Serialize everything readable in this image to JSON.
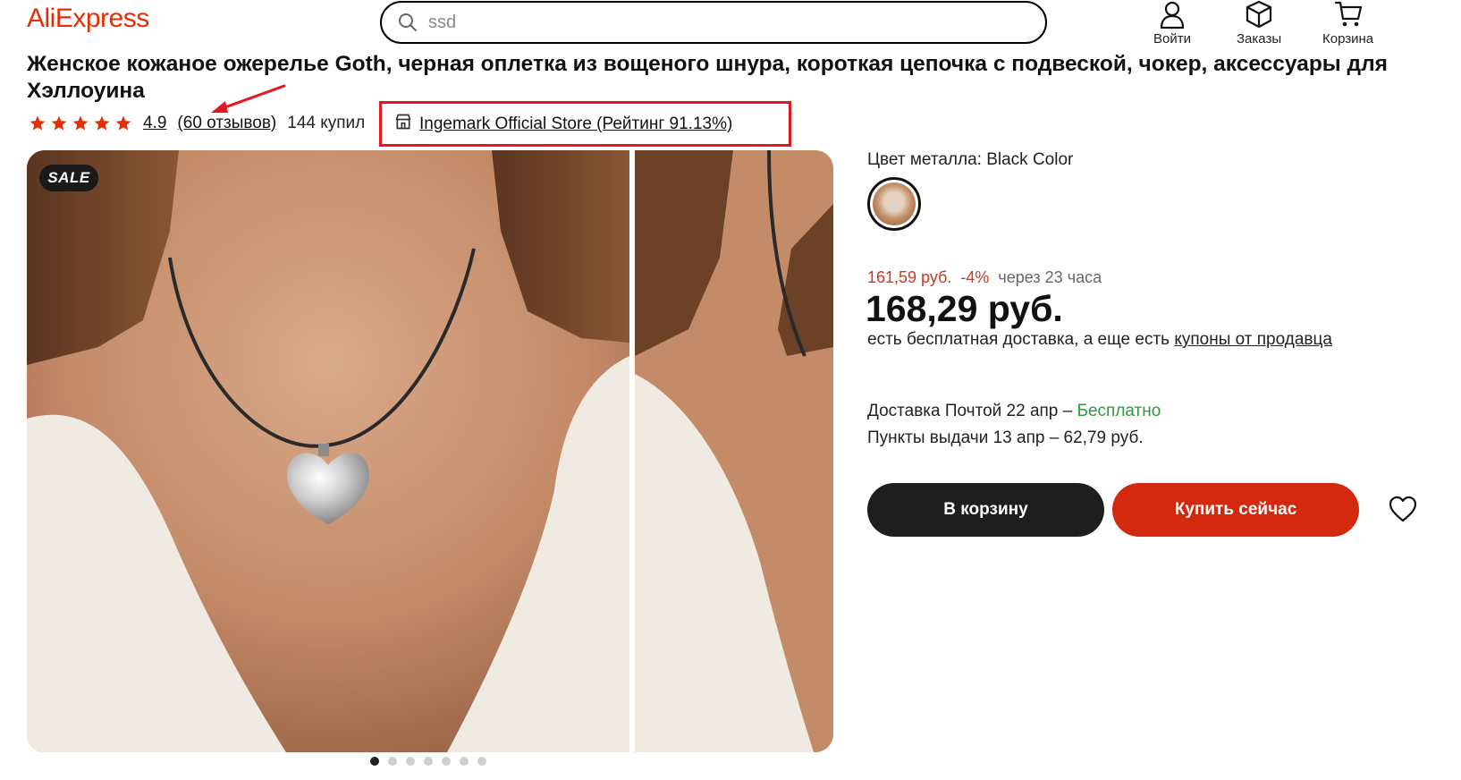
{
  "header": {
    "logo_text": "AliExpress",
    "search": {
      "value": "ssd",
      "icon": "search-icon"
    },
    "nav": [
      {
        "label": "Войти",
        "icon": "user-icon"
      },
      {
        "label": "Заказы",
        "icon": "package-icon"
      },
      {
        "label": "Корзина",
        "icon": "cart-icon"
      }
    ]
  },
  "product": {
    "title": "Женское кожаное ожерелье Goth, черная оплетка из вощеного шнура, короткая цепочка с подвеской, чокер, аксессуары для Хэллоуина",
    "rating": "4.9",
    "stars": 5,
    "reviews": "(60 отзывов)",
    "sold": "144 купил",
    "store": "Ingemark Official Store (Рейтинг 91.13%)",
    "sale_badge": "SALE",
    "gallery": {
      "slide_count": 7,
      "active_slide": 1
    },
    "color_label": "Цвет металла: Black Color",
    "old_price": "161,59 руб.",
    "discount": "-4%",
    "timer": "через 23 часа",
    "price": "168,29 руб.",
    "shipping_note_prefix": "есть бесплатная доставка, а еще есть ",
    "shipping_note_link": "купоны от продавца",
    "delivery_post": "Доставка Почтой 22 апр – ",
    "delivery_post_free": "Бесплатно",
    "delivery_pickup": "Пункты выдачи 13 апр – 62,79 руб.",
    "add_to_cart": "В корзину",
    "buy_now": "Купить сейчас"
  },
  "colors": {
    "brand": "#e62e04",
    "buy_button": "#d3290f",
    "cart_button": "#1e1e1e",
    "star": "#e62e04",
    "free_delivery": "#2a9a3a",
    "annotation": "#e8141e"
  }
}
